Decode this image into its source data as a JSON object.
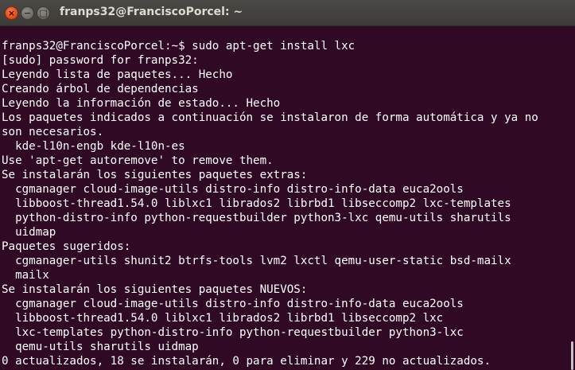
{
  "window": {
    "title": "franps32@FranciscoPorcel: ~",
    "close_glyph": "×",
    "minimize_glyph": "−",
    "maximize_glyph": "□"
  },
  "terminal": {
    "lines": [
      "franps32@FranciscoPorcel:~$ sudo apt-get install lxc",
      "[sudo] password for franps32:",
      "Leyendo lista de paquetes... Hecho",
      "Creando árbol de dependencias",
      "Leyendo la información de estado... Hecho",
      "Los paquetes indicados a continuación se instalaron de forma automática y ya no",
      "son necesarios.",
      "  kde-l10n-engb kde-l10n-es",
      "Use 'apt-get autoremove' to remove them.",
      "Se instalarán los siguientes paquetes extras:",
      "  cgmanager cloud-image-utils distro-info distro-info-data euca2ools",
      "  libboost-thread1.54.0 liblxc1 librados2 librbd1 libseccomp2 lxc-templates",
      "  python-distro-info python-requestbuilder python3-lxc qemu-utils sharutils",
      "  uidmap",
      "Paquetes sugeridos:",
      "  cgmanager-utils shunit2 btrfs-tools lvm2 lxctl qemu-user-static bsd-mailx",
      "  mailx",
      "Se instalarán los siguientes paquetes NUEVOS:",
      "  cgmanager cloud-image-utils distro-info distro-info-data euca2ools",
      "  libboost-thread1.54.0 liblxc1 librados2 librbd1 libseccomp2 lxc",
      "  lxc-templates python-distro-info python-requestbuilder python3-lxc",
      "  qemu-utils sharutils uidmap",
      "0 actualizados, 18 se instalarán, 0 para eliminar y 229 no actualizados."
    ]
  },
  "colors": {
    "terminal_background": "#300a24",
    "terminal_text": "#ffffff",
    "titlebar": "#3c3b37",
    "close_button": "#df4a16"
  }
}
